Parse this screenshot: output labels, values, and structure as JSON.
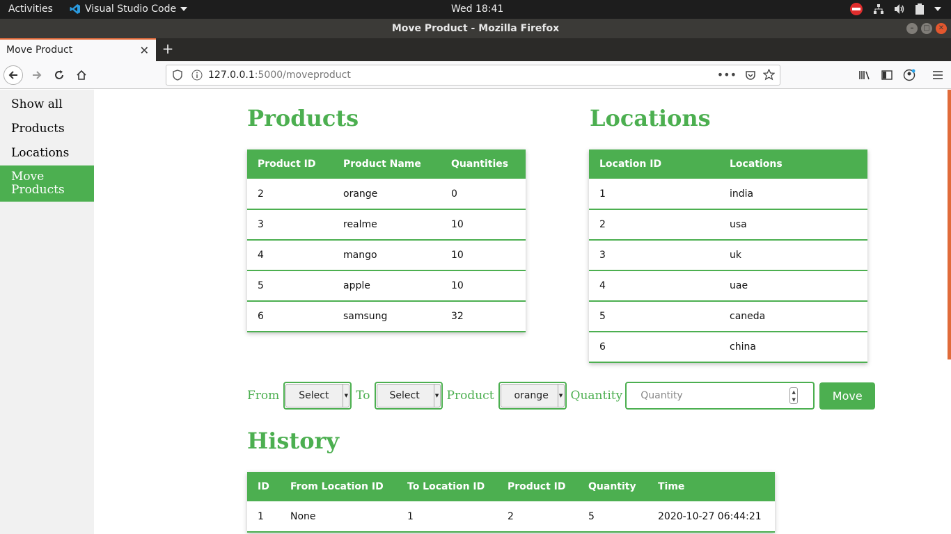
{
  "system": {
    "activities": "Activities",
    "app_name": "Visual Studio Code",
    "clock": "Wed 18:41"
  },
  "window": {
    "title": "Move Product - Mozilla Firefox"
  },
  "browser": {
    "tab_title": "Move Product",
    "url_host": "127.0.0.1",
    "url_rest": ":5000/moveproduct"
  },
  "sidebar": {
    "items": [
      {
        "label": "Show all"
      },
      {
        "label": "Products"
      },
      {
        "label": "Locations"
      },
      {
        "label": "Move Products"
      }
    ]
  },
  "products": {
    "title": "Products",
    "headers": [
      "Product ID",
      "Product Name",
      "Quantities"
    ],
    "rows": [
      [
        "2",
        "orange",
        "0"
      ],
      [
        "3",
        "realme",
        "10"
      ],
      [
        "4",
        "mango",
        "10"
      ],
      [
        "5",
        "apple",
        "10"
      ],
      [
        "6",
        "samsung",
        "32"
      ]
    ]
  },
  "locations": {
    "title": "Locations",
    "headers": [
      "Location ID",
      "Locations"
    ],
    "rows": [
      [
        "1",
        "india"
      ],
      [
        "2",
        "usa"
      ],
      [
        "3",
        "uk"
      ],
      [
        "4",
        "uae"
      ],
      [
        "5",
        "caneda"
      ],
      [
        "6",
        "china"
      ]
    ]
  },
  "move_form": {
    "from_label": "From",
    "from_value": "Select",
    "to_label": "To",
    "to_value": "Select",
    "product_label": "Product",
    "product_value": "orange",
    "quantity_label": "Quantity",
    "quantity_placeholder": "Quantity",
    "submit_label": "Move"
  },
  "history": {
    "title": "History",
    "headers": [
      "ID",
      "From Location ID",
      "To Location ID",
      "Product ID",
      "Quantity",
      "Time"
    ],
    "rows": [
      [
        "1",
        "None",
        "1",
        "2",
        "5",
        "2020-10-27 06:44:21"
      ]
    ]
  },
  "colors": {
    "accent": "#4caf50",
    "tab_highlight": "#e66d3c"
  }
}
